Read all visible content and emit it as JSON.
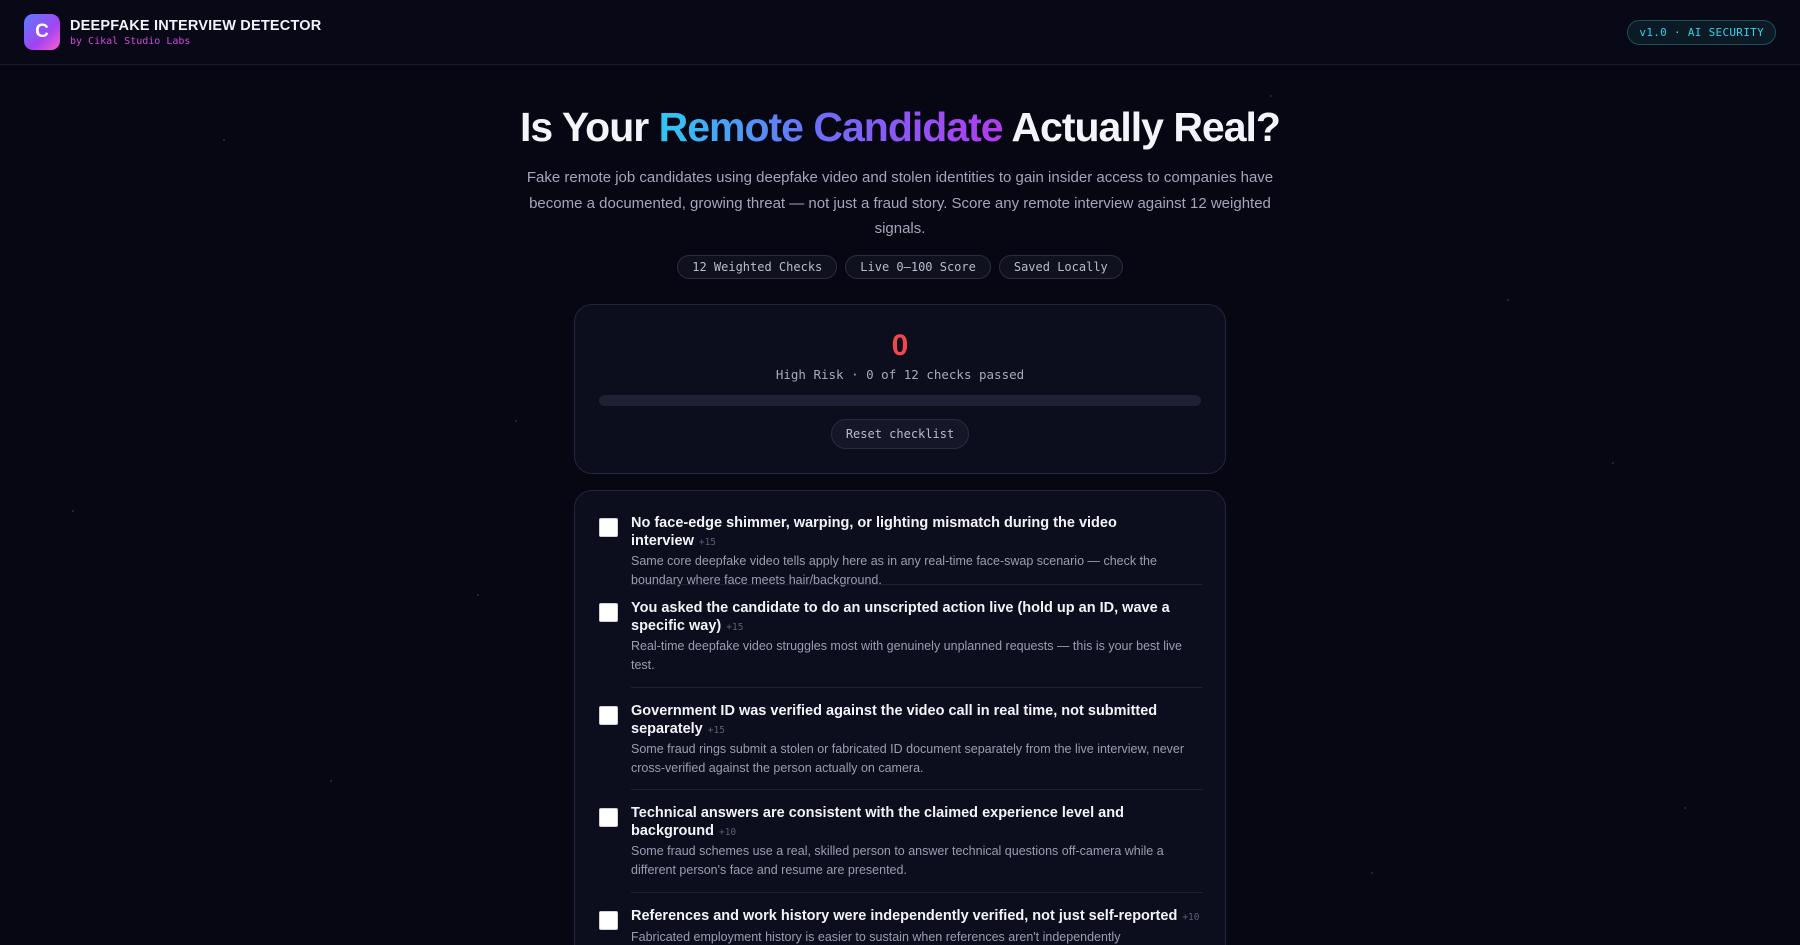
{
  "header": {
    "logo_letter": "C",
    "title": "DEEPFAKE INTERVIEW DETECTOR",
    "subtitle": "by Cikal Studio Labs",
    "version": "v1.0 · AI SECURITY"
  },
  "hero": {
    "title_prefix": "Is Your ",
    "title_highlight": "Remote Candidate",
    "title_suffix": " Actually Real?",
    "description": "Fake remote job candidates using deepfake video and stolen identities to gain insider access to companies have become a documented, growing threat — not just a fraud story. Score any remote interview against 12 weighted signals.",
    "chips": [
      "12 Weighted Checks",
      "Live 0–100 Score",
      "Saved Locally"
    ]
  },
  "score": {
    "value": "0",
    "status": "High Risk · 0 of 12 checks passed",
    "progress_fraction": 0,
    "reset_label": "Reset checklist"
  },
  "checklist": {
    "items": [
      {
        "title": "No face-edge shimmer, warping, or lighting mismatch during the video interview",
        "weight": "+15",
        "description": "Same core deepfake video tells apply here as in any real-time face-swap scenario — check the boundary where face meets hair/background.",
        "checked": false
      },
      {
        "title": "You asked the candidate to do an unscripted action live (hold up an ID, wave a specific way)",
        "weight": "+15",
        "description": "Real-time deepfake video struggles most with genuinely unplanned requests — this is your best live test.",
        "checked": false
      },
      {
        "title": "Government ID was verified against the video call in real time, not submitted separately",
        "weight": "+15",
        "description": "Some fraud rings submit a stolen or fabricated ID document separately from the live interview, never cross-verified against the person actually on camera.",
        "checked": false
      },
      {
        "title": "Technical answers are consistent with the claimed experience level and background",
        "weight": "+10",
        "description": "Some fraud schemes use a real, skilled person to answer technical questions off-camera while a different person's face and resume are presented.",
        "checked": false
      },
      {
        "title": "References and work history were independently verified, not just self-reported",
        "weight": "+10",
        "description": "Fabricated employment history is easier to sustain when references aren't independently",
        "checked": false
      }
    ]
  }
}
